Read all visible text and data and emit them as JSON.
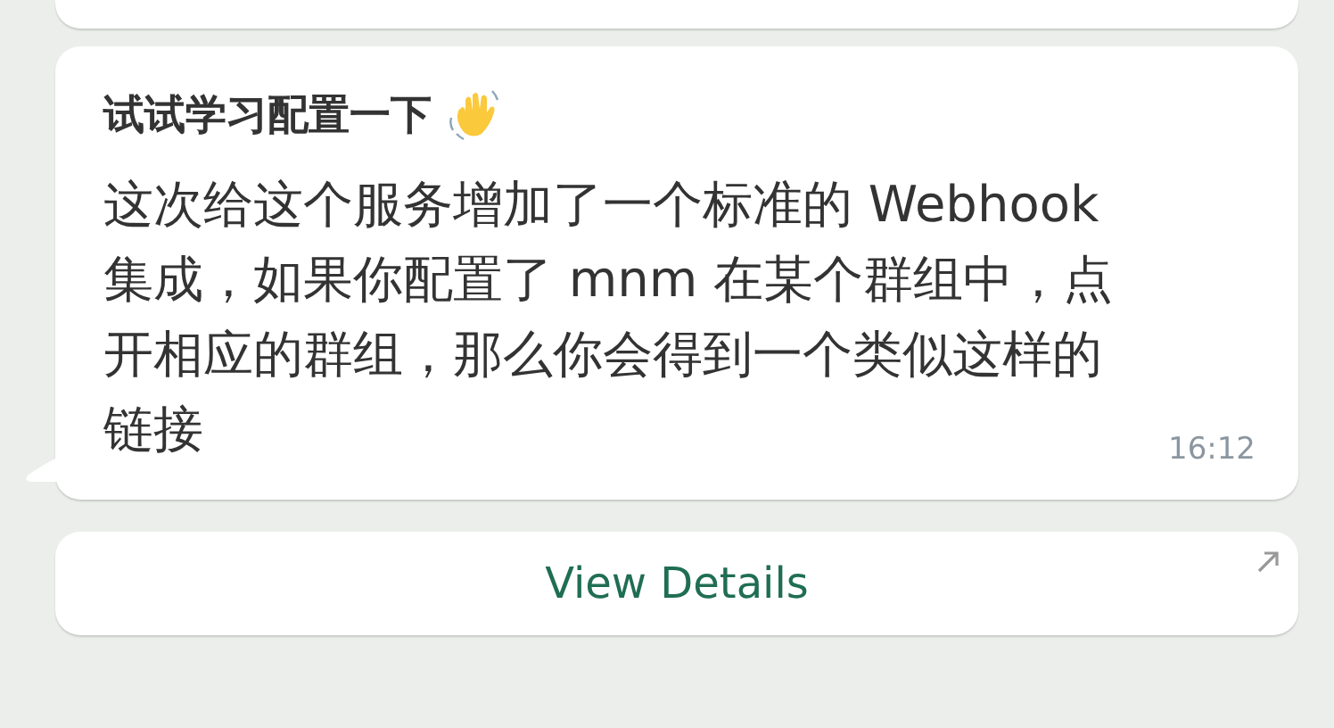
{
  "message": {
    "title": "试试学习配置一下",
    "body": "这次给这个服务增加了一个标准的 Webhook 集成，如果你配置了 mnm 在某个群组中，点开相应的群组，那么你会得到一个类似这样的链接",
    "time": "16:12"
  },
  "button": {
    "label": "View Details"
  }
}
